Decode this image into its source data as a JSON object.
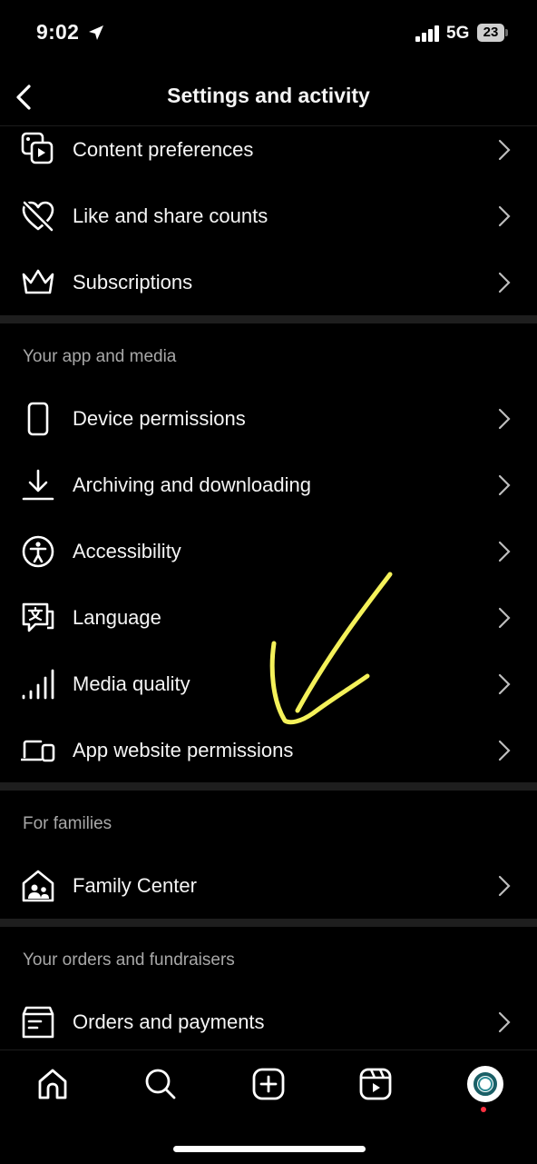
{
  "status_bar": {
    "time": "9:02",
    "network": "5G",
    "battery": "23"
  },
  "header": {
    "title": "Settings and activity"
  },
  "sections": [
    {
      "items": [
        {
          "label": "Content preferences",
          "icon": "content-preferences-icon"
        },
        {
          "label": "Like and share counts",
          "icon": "heart-crossed-icon"
        },
        {
          "label": "Subscriptions",
          "icon": "crown-icon"
        }
      ]
    },
    {
      "header": "Your app and media",
      "items": [
        {
          "label": "Device permissions",
          "icon": "phone-icon"
        },
        {
          "label": "Archiving and downloading",
          "icon": "download-icon"
        },
        {
          "label": "Accessibility",
          "icon": "accessibility-icon"
        },
        {
          "label": "Language",
          "icon": "language-icon"
        },
        {
          "label": "Media quality",
          "icon": "signal-bars-icon"
        },
        {
          "label": "App website permissions",
          "icon": "laptop-phone-icon"
        }
      ]
    },
    {
      "header": "For families",
      "items": [
        {
          "label": "Family Center",
          "icon": "family-home-icon"
        }
      ]
    },
    {
      "header": "Your orders and fundraisers",
      "items": [
        {
          "label": "Orders and payments",
          "icon": "orders-icon"
        }
      ]
    }
  ],
  "tab_bar": [
    {
      "name": "home",
      "icon": "home-icon"
    },
    {
      "name": "search",
      "icon": "search-icon"
    },
    {
      "name": "create",
      "icon": "plus-square-icon"
    },
    {
      "name": "reels",
      "icon": "reels-icon"
    },
    {
      "name": "profile",
      "icon": "profile-avatar"
    }
  ],
  "colors": {
    "background": "#000000",
    "text": "#f5f5f5",
    "section_header": "#a8a8a8",
    "divider": "#1e1e1e",
    "annotation": "#f4f15a",
    "notification_dot": "#ff3040"
  }
}
